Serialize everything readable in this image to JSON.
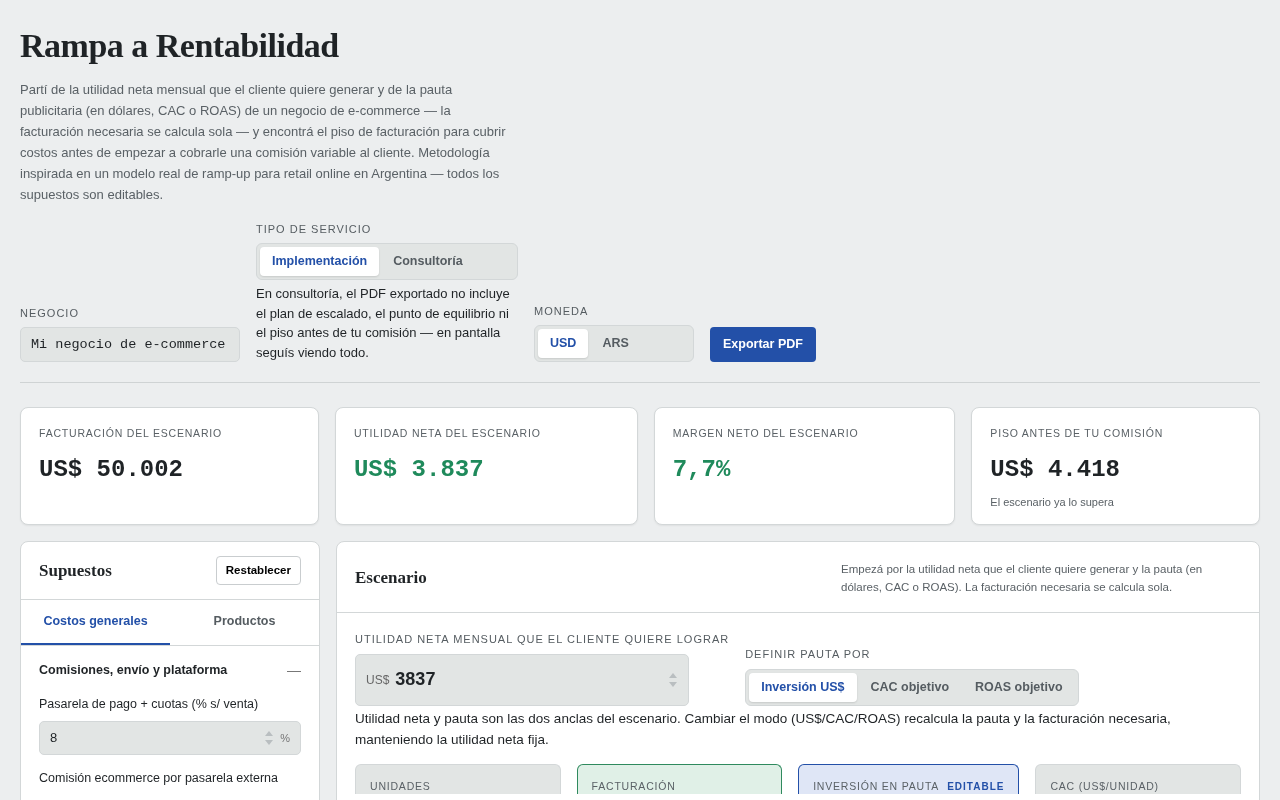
{
  "title": "Rampa a Rentabilidad",
  "description": "Partí de la utilidad neta mensual que el cliente quiere generar y de la pauta publicitaria (en dólares, CAC o ROAS) de un negocio de e-commerce — la facturación necesaria se calcula sola — y encontrá el piso de facturación para cubrir costos antes de empezar a cobrarle una comisión variable al cliente. Metodología inspirada en un modelo real de ramp-up para retail online en Argentina — todos los supuestos son editables.",
  "negocio": {
    "label": "NEGOCIO",
    "value": "Mi negocio de e-commerce"
  },
  "tipo_servicio": {
    "label": "TIPO DE SERVICIO",
    "options": [
      {
        "label": "Implementación",
        "selected": true
      },
      {
        "label": "Consultoría",
        "selected": false
      }
    ],
    "note": "En consultoría, el PDF exportado no incluye el plan de escalado, el punto de equilibrio ni el piso antes de tu comisión — en pantalla seguís viendo todo."
  },
  "moneda": {
    "label": "MONEDA",
    "options": [
      {
        "label": "USD",
        "selected": true
      },
      {
        "label": "ARS",
        "selected": false
      }
    ]
  },
  "export_button": "Exportar PDF",
  "stats": [
    {
      "label": "FACTURACIÓN DEL ESCENARIO",
      "value": "US$ 50.002",
      "positive": false
    },
    {
      "label": "UTILIDAD NETA DEL ESCENARIO",
      "value": "US$ 3.837",
      "positive": true
    },
    {
      "label": "MARGEN NETO DEL ESCENARIO",
      "value": "7,7%",
      "positive": true
    },
    {
      "label": "PISO ANTES DE TU COMISIÓN",
      "value": "US$ 4.418",
      "positive": false,
      "note": "El escenario ya lo supera"
    }
  ],
  "supuestos": {
    "title": "Supuestos",
    "reset_button": "Restablecer",
    "tabs": [
      {
        "label": "Costos generales",
        "selected": true
      },
      {
        "label": "Productos",
        "selected": false
      }
    ],
    "section": {
      "title": "Comisiones, envío y plataforma",
      "expanded": true,
      "toggle": "—",
      "fields": [
        {
          "label": "Pasarela de pago + cuotas (% s/ venta)",
          "value": "8",
          "unit": "%"
        },
        {
          "label": "Comisión ecommerce por pasarela externa"
        }
      ]
    }
  },
  "escenario": {
    "title": "Escenario",
    "hint": "Empezá por la utilidad neta que el cliente quiere generar y la pauta (en dólares, CAC o ROAS). La facturación necesaria se calcula sola.",
    "utilidad": {
      "label": "UTILIDAD NETA MENSUAL QUE EL CLIENTE QUIERE LOGRAR",
      "prefix": "US$",
      "value": "3837"
    },
    "pauta": {
      "label": "DEFINIR PAUTA POR",
      "options": [
        {
          "label": "Inversión US$",
          "selected": true
        },
        {
          "label": "CAC objetivo",
          "selected": false
        },
        {
          "label": "ROAS objetivo",
          "selected": false
        }
      ]
    },
    "note": "Utilidad neta y pauta son las dos anclas del escenario. Cambiar el modo (US$/CAC/ROAS) recalcula la pauta y la facturación necesaria, manteniendo la utilidad neta fija.",
    "metrics": [
      {
        "label": "UNIDADES",
        "kind": "neutral"
      },
      {
        "label": "FACTURACIÓN",
        "kind": "result"
      },
      {
        "label": "INVERSIÓN EN PAUTA",
        "kind": "input",
        "badge": "EDITABLE"
      },
      {
        "label": "CAC (US$/UNIDAD)",
        "kind": "neutral"
      }
    ]
  }
}
